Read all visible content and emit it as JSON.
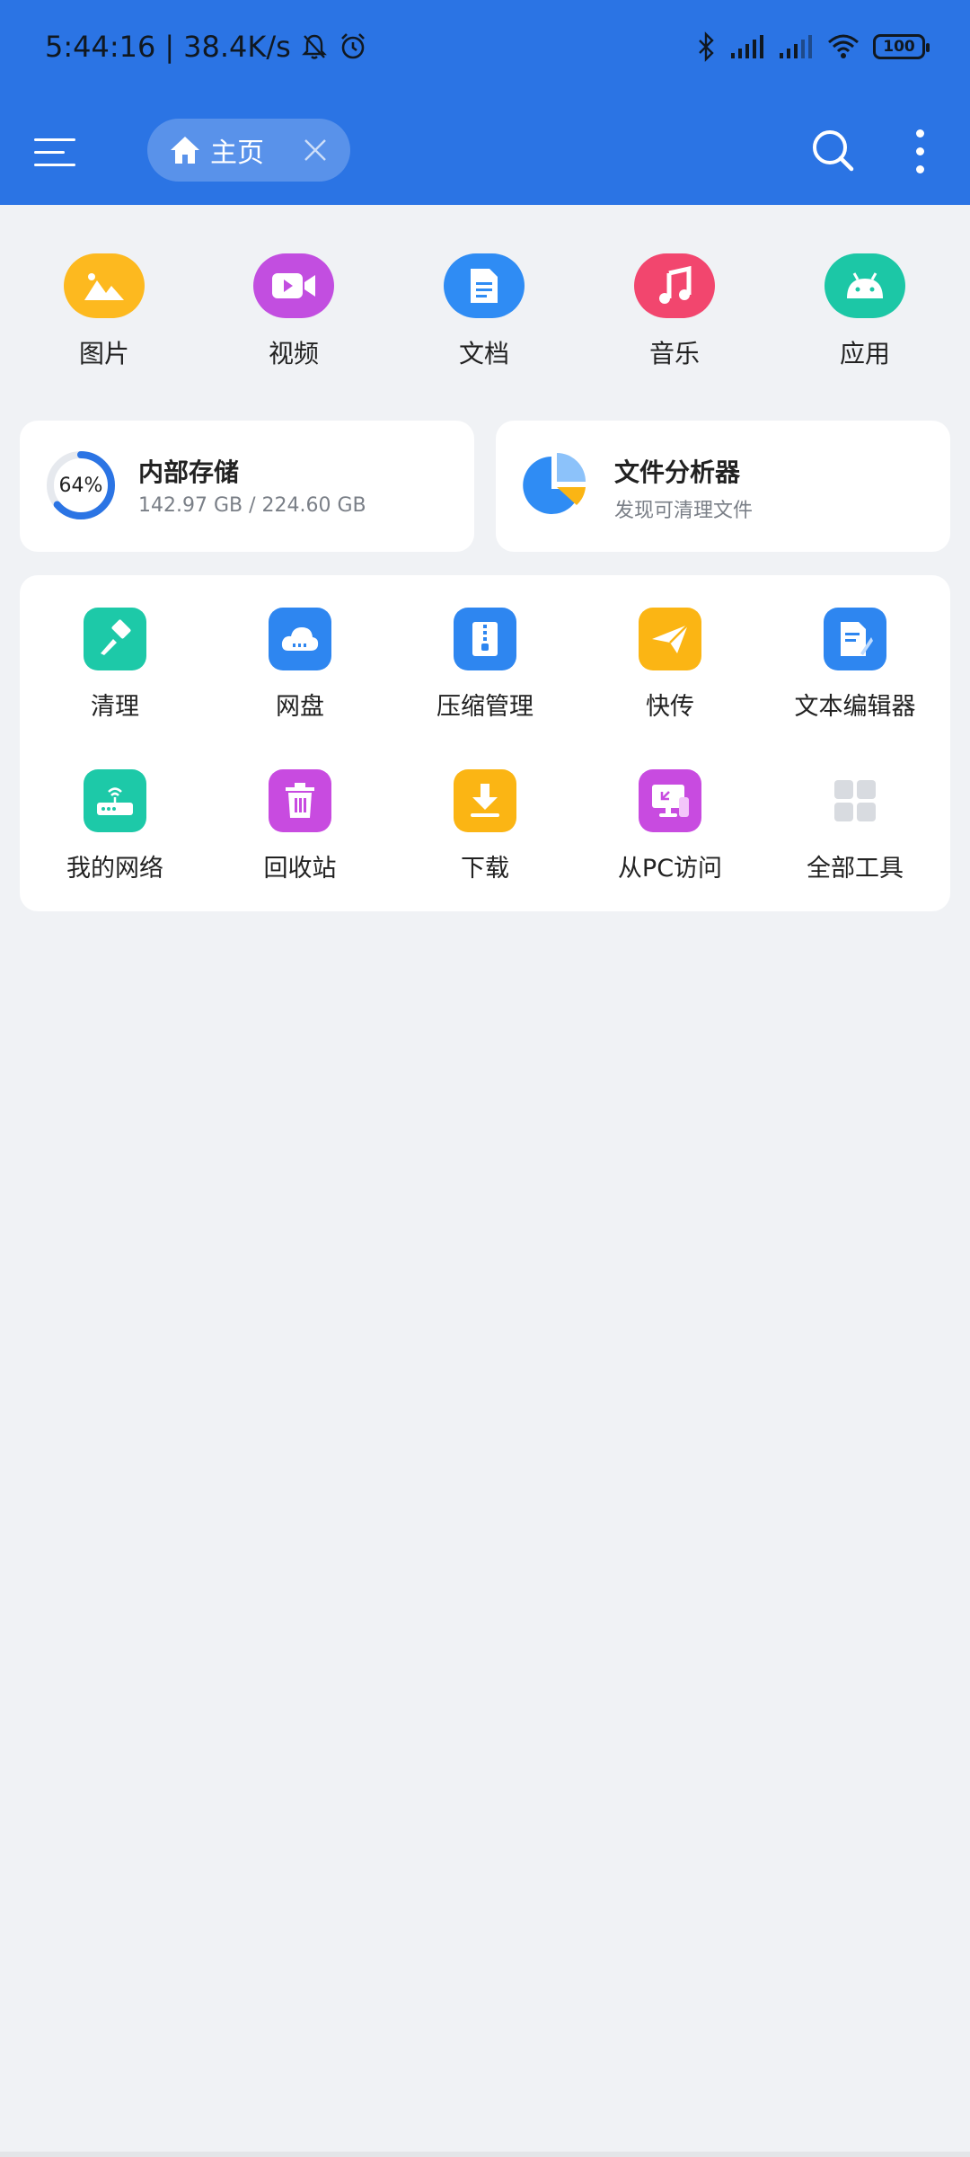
{
  "status_bar": {
    "time": "5:44:16",
    "net_speed": "38.4K/s",
    "battery": "100"
  },
  "header": {
    "tab_label": "主页"
  },
  "categories": [
    {
      "label": "图片",
      "icon": "image-icon",
      "color": "#FDB91F"
    },
    {
      "label": "视频",
      "icon": "video-icon",
      "color": "#C24EE0"
    },
    {
      "label": "文档",
      "icon": "document-icon",
      "color": "#2F8CF4"
    },
    {
      "label": "音乐",
      "icon": "music-icon",
      "color": "#F2466E"
    },
    {
      "label": "应用",
      "icon": "android-icon",
      "color": "#1CC7A6"
    }
  ],
  "storage": {
    "percent": "64%",
    "percent_value": 0.64,
    "title": "内部存储",
    "usage": "142.97 GB / 224.60 GB"
  },
  "analyzer": {
    "title": "文件分析器",
    "subtitle": "发现可清理文件"
  },
  "tools": [
    {
      "label": "清理",
      "icon": "broom-icon",
      "color": "#1DC9A8"
    },
    {
      "label": "网盘",
      "icon": "cloud-icon",
      "color": "#2E86F0"
    },
    {
      "label": "压缩管理",
      "icon": "zip-icon",
      "color": "#2E86F0"
    },
    {
      "label": "快传",
      "icon": "paper-plane-icon",
      "color": "#FBB514"
    },
    {
      "label": "文本编辑器",
      "icon": "text-edit-icon",
      "color": "#2E86F0"
    },
    {
      "label": "我的网络",
      "icon": "router-icon",
      "color": "#1DC9A8"
    },
    {
      "label": "回收站",
      "icon": "trash-icon",
      "color": "#C84BE0"
    },
    {
      "label": "下载",
      "icon": "download-icon",
      "color": "#FBB514"
    },
    {
      "label": "从PC访问",
      "icon": "pc-access-icon",
      "color": "#C84BE0"
    },
    {
      "label": "全部工具",
      "icon": "grid-icon",
      "color": "#D8DBE0"
    }
  ]
}
